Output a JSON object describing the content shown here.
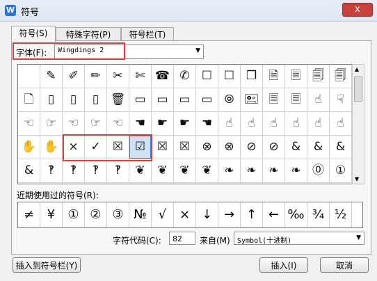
{
  "window": {
    "title": "符号",
    "app_icon_letter": "W",
    "close_label": "x"
  },
  "tabs": [
    {
      "label": "符号(S)"
    },
    {
      "label": "特殊字符(P)"
    },
    {
      "label": "符号栏(T)"
    }
  ],
  "font": {
    "label": "字体(F):",
    "value": "Wingdings 2"
  },
  "symbol_grid": {
    "rows": [
      [
        "",
        "✎",
        "✐",
        "✏",
        "✂",
        "✄",
        "☎",
        "✆",
        "☐",
        "☐",
        "❐",
        "🗎",
        "🗏",
        "🗐",
        "🗐"
      ],
      [
        "🗋",
        "▯",
        "▯",
        "▯",
        "🗑",
        "▭",
        "▭",
        "▭",
        "▭",
        "⦾",
        "🖭",
        "🗏",
        "🗏",
        "☝",
        "☟"
      ],
      [
        "☜",
        "☞",
        "☜",
        "☞",
        "☜",
        "☚",
        "☛",
        "☛",
        "☚",
        "☝",
        "☝",
        "☝",
        "☝",
        "☝",
        "☝"
      ],
      [
        "✋",
        "✋",
        "×",
        "✓",
        "☒",
        "☑",
        "☒",
        "☒",
        "⊗",
        "⊗",
        "⊘",
        "⊘",
        "&",
        "&",
        "&"
      ],
      [
        "&",
        "‽",
        "‽",
        "‽",
        "‽",
        "❦",
        "❦",
        "❦",
        "❦",
        "❧",
        "❧",
        "❧",
        "❧",
        "⓪",
        "①"
      ]
    ],
    "selected_row": 3,
    "selected_col": 5
  },
  "recent": {
    "label": "近期使用过的符号(R):",
    "symbols": [
      "≠",
      "¥",
      "①",
      "②",
      "③",
      "№",
      "√",
      "×",
      "↓",
      "→",
      "↑",
      "←",
      "‰",
      "¾",
      "½"
    ]
  },
  "char_code": {
    "label": "字符代码(C):",
    "value": "82"
  },
  "from": {
    "label": "来自(M)",
    "value": "Symbol(十进制)"
  },
  "buttons": {
    "insert_to_bar": "插入到符号栏(Y)",
    "insert": "插入(I)",
    "cancel": "取消"
  },
  "colors": {
    "highlight": "#e03c3c",
    "selected": "#cfe3f7"
  }
}
